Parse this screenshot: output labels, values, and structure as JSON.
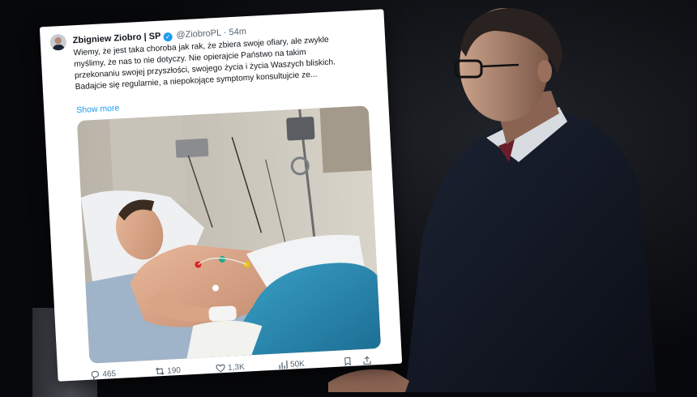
{
  "tweet": {
    "author_name": "Zbigniew Ziobro | SP",
    "handle": "@ZiobroPL",
    "separator": "·",
    "time_ago": "54m",
    "text_lines": [
      "Wiemy, że jest taka choroba jak rak, że zbiera swoje ofiary, ale zwykle",
      "myślimy, że nas to nie dotyczy. Nie opierajcie Państwo na takim",
      "przekonaniu swojej przyszłości, swojego życia i życia Waszych bliskich.",
      "Badajcie się regularnie, a niepokojące symptomy konsultujcie ze..."
    ],
    "show_more_label": "Show more",
    "stats": {
      "replies": "465",
      "reposts": "190",
      "likes": "1,3K",
      "views": "50K"
    }
  },
  "colors": {
    "accent": "#1d9bf0",
    "background": "#07080b",
    "card": "#ffffff"
  },
  "icons": [
    "verified-icon",
    "reply-icon",
    "repost-icon",
    "like-icon",
    "views-icon",
    "bookmark-icon",
    "share-icon"
  ]
}
